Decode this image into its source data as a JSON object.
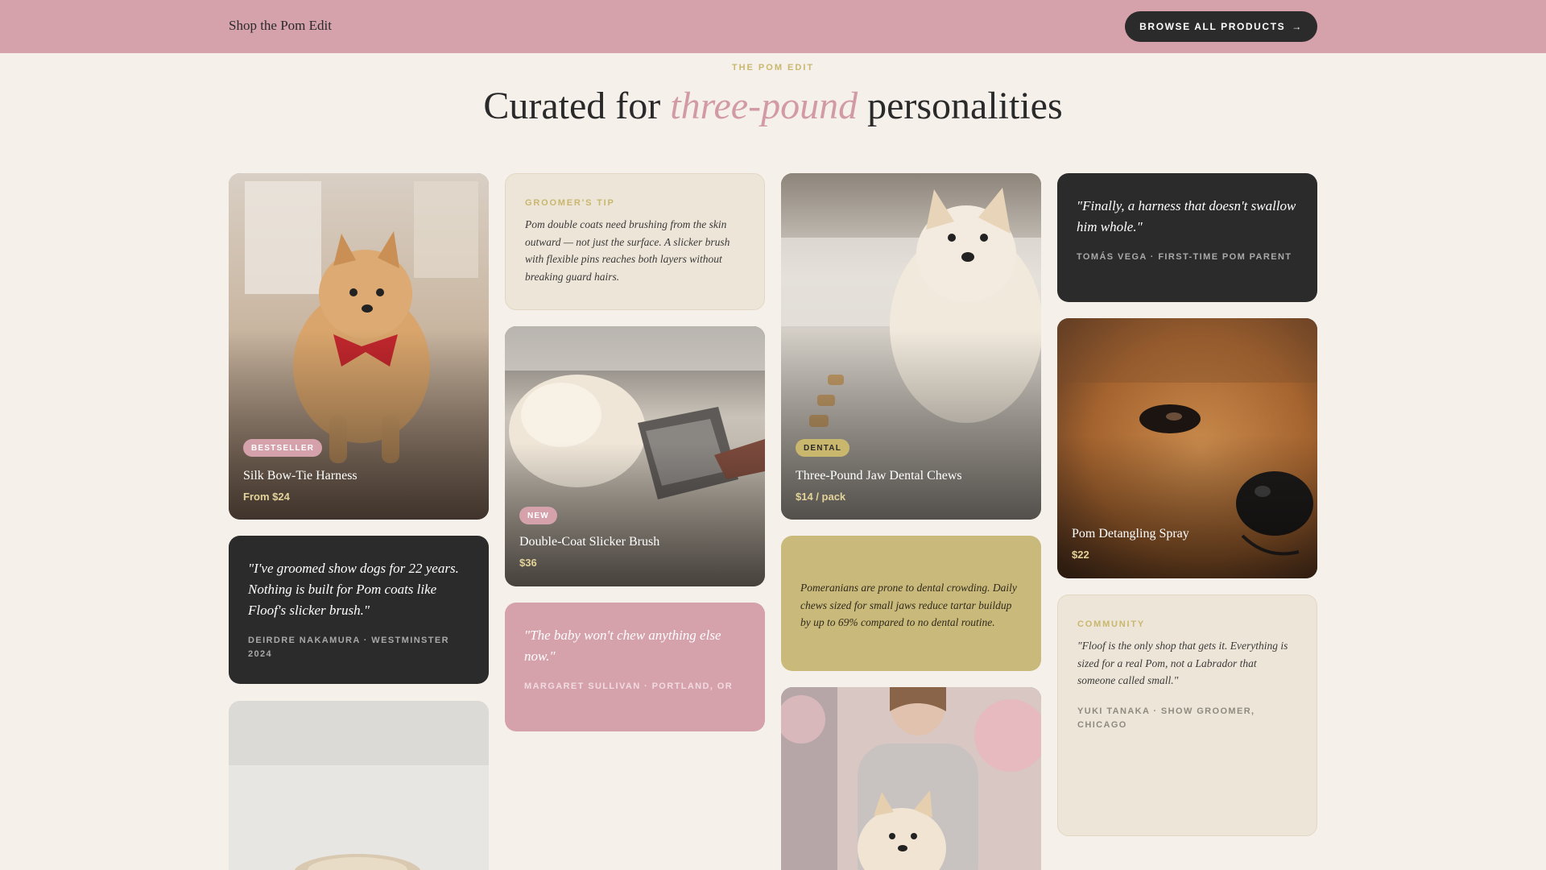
{
  "header": {
    "shop_link": "Shop the Pom Edit",
    "browse_label": "BROWSE ALL PRODUCTS",
    "browse_arrow": "→"
  },
  "hero": {
    "eyebrow": "THE POM EDIT",
    "headline_start": "Curated for ",
    "headline_accent": "three-pound",
    "headline_end": " personalities"
  },
  "products": [
    {
      "badge": "BESTSELLER",
      "name": "Silk Bow-Tie Harness",
      "price": "From $24"
    },
    {
      "badge": "NEW",
      "name": "Double-Coat Slicker Brush",
      "price": "$36"
    },
    {
      "badge": "DENTAL",
      "name": "Three-Pound Jaw Dental Chews",
      "price": "$14 / pack"
    },
    {
      "badge": "",
      "name": "Pom Detangling Spray",
      "price": "$22"
    }
  ],
  "tips": {
    "groomer_label": "GROOMER'S TIP",
    "groomer_text": "Pom double coats need brushing from the skin outward — not just the surface. A slicker brush with flexible pins reaches both layers without breaking guard hairs.",
    "dental_text": "Pomeranians are prone to dental crowding. Daily chews sized for small jaws reduce tartar buildup by up to 69% compared to no dental routine.",
    "community_label": "COMMUNITY",
    "community_quote": "\"Floof is the only shop that gets it. Everything is sized for a real Pom, not a Labrador that someone called small.\"",
    "community_attr": "YUKI TANAKA · SHOW GROOMER, CHICAGO"
  },
  "testimonials": [
    {
      "quote": "\"I've groomed show dogs for 22 years. Nothing is built for Pom coats like Floof's slicker brush.\"",
      "attr": "DEIRDRE NAKAMURA · WESTMINSTER 2024"
    },
    {
      "quote": "\"The baby won't chew anything else now.\"",
      "attr": "MARGARET SULLIVAN · PORTLAND, OR"
    },
    {
      "quote": "\"Finally, a harness that doesn't swallow him whole.\"",
      "attr": "TOMÁS VEGA · FIRST-TIME POM PARENT"
    }
  ],
  "colors": {
    "accent_pink": "#d5a1ab",
    "accent_gold": "#c9b76d",
    "dark": "#2b2b2b",
    "background": "#f5f1ea"
  }
}
